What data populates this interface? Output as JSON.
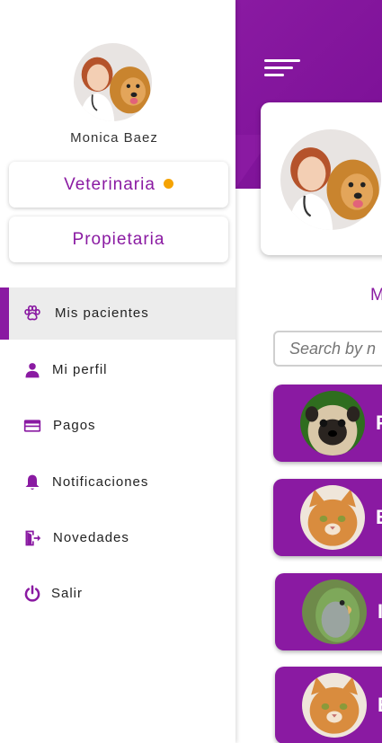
{
  "drawer": {
    "user_name": "Monica Baez",
    "roles": [
      {
        "label": "Veterinaria",
        "active": true
      },
      {
        "label": "Propietaria",
        "active": false
      }
    ],
    "nav": [
      {
        "label": "Mis pacientes",
        "icon": "paw-icon",
        "active": true
      },
      {
        "label": "Mi perfil",
        "icon": "person-icon",
        "active": false
      },
      {
        "label": "Pagos",
        "icon": "credit-card-icon",
        "active": false
      },
      {
        "label": "Notificaciones",
        "icon": "bell-icon",
        "active": false
      },
      {
        "label": "Novedades",
        "icon": "exit-door-icon",
        "active": false
      },
      {
        "label": "Salir",
        "icon": "power-icon",
        "active": false
      }
    ]
  },
  "main": {
    "section_title": "M",
    "search_placeholder": "Search by n",
    "patients": [
      {
        "initial": "F",
        "animal": "pug-dog"
      },
      {
        "initial": "E",
        "animal": "orange-cat"
      },
      {
        "initial": "I",
        "animal": "green-parrot"
      },
      {
        "initial": "E",
        "animal": "orange-cat"
      }
    ]
  },
  "colors": {
    "brand_purple": "#8a1aa2",
    "active_dot": "#f5a302",
    "active_bg": "#ececec"
  }
}
